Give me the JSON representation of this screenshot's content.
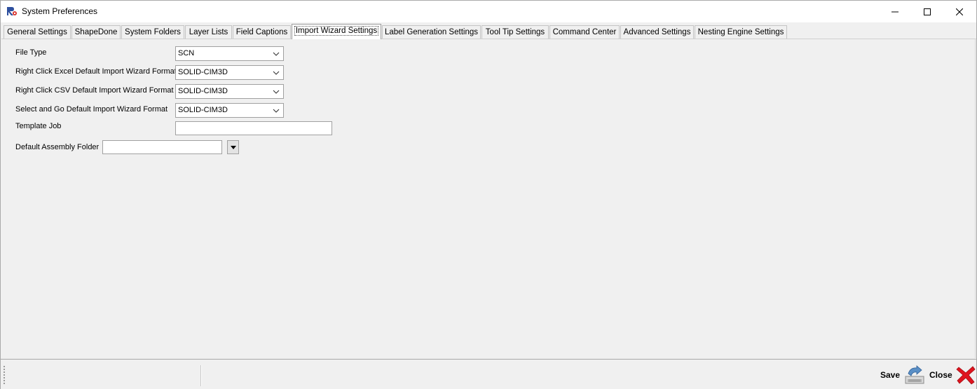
{
  "window": {
    "title": "System Preferences"
  },
  "tabs": [
    {
      "label": "General Settings"
    },
    {
      "label": "ShapeDone"
    },
    {
      "label": "System Folders"
    },
    {
      "label": "Layer Lists"
    },
    {
      "label": "Field Captions"
    },
    {
      "label": "Import Wizard Settings",
      "active": true
    },
    {
      "label": "Label Generation Settings"
    },
    {
      "label": "Tool Tip Settings"
    },
    {
      "label": "Command Center"
    },
    {
      "label": "Advanced Settings"
    },
    {
      "label": "Nesting Engine Settings"
    }
  ],
  "form": {
    "file_type": {
      "label": "File Type",
      "value": "SCN"
    },
    "excel_format": {
      "label": "Right Click Excel Default Import Wizard Format",
      "value": "SOLID-CIM3D"
    },
    "csv_format": {
      "label": "Right Click CSV Default Import Wizard Format",
      "value": "SOLID-CIM3D"
    },
    "select_go_format": {
      "label": "Select and Go Default Import Wizard Format",
      "value": "SOLID-CIM3D"
    },
    "template_job": {
      "label": "Template Job",
      "value": ""
    },
    "assembly_folder": {
      "label": "Default Assembly Folder",
      "value": ""
    }
  },
  "statusbar": {
    "save_label": "Save",
    "close_label": "Close"
  },
  "icons": {
    "app": "app-logo-icon",
    "minimize": "minimize-icon",
    "maximize": "maximize-icon",
    "close": "close-icon",
    "save": "save-disk-icon",
    "close_red": "red-x-icon"
  },
  "colors": {
    "close_x": "#e0141e",
    "save_icon": "#5a8fc6"
  }
}
